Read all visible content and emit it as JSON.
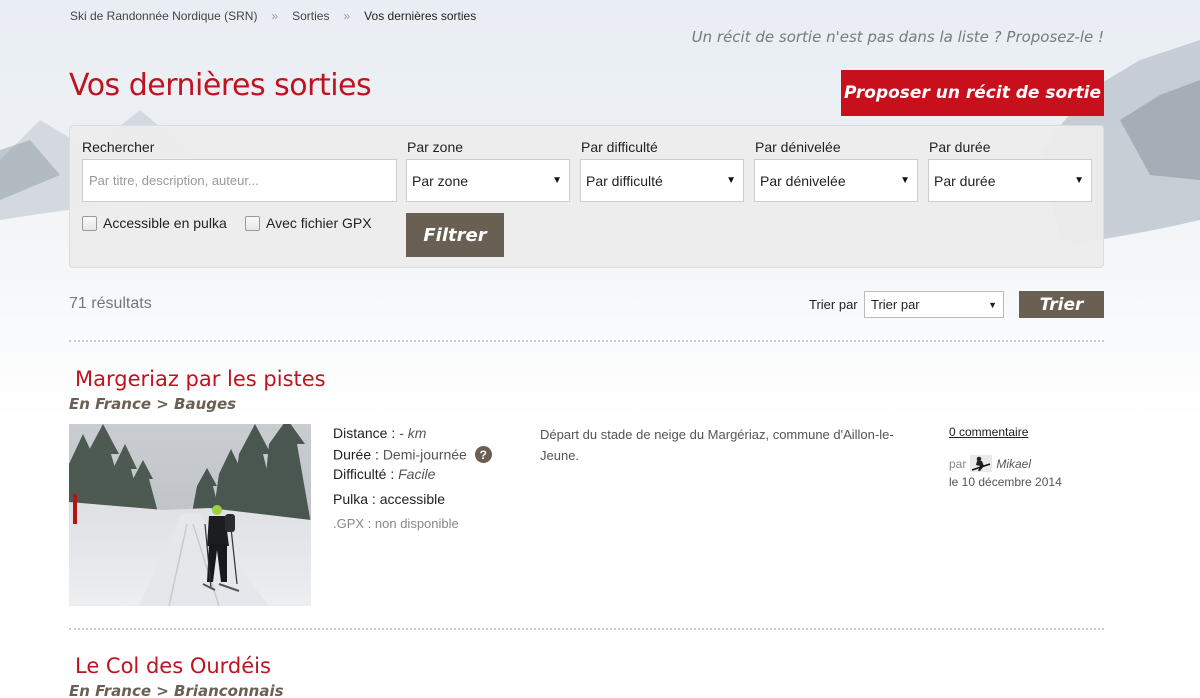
{
  "breadcrumb": {
    "items": [
      "Ski de Randonnée Nordique (SRN)",
      "Sorties",
      "Vos dernières sorties"
    ],
    "separator": "»"
  },
  "header": {
    "propose_text": "Un récit de sortie n'est pas dans la liste ? Proposez-le !",
    "title": "Vos dernières sorties",
    "propose_button": "Proposer un récit de sortie"
  },
  "filters": {
    "search_label": "Rechercher",
    "search_placeholder": "Par titre, description, auteur...",
    "zone_label": "Par zone",
    "zone_value": "Par zone",
    "difficulty_label": "Par difficulté",
    "difficulty_value": "Par difficulté",
    "elevation_label": "Par dénivelée",
    "elevation_value": "Par dénivelée",
    "duration_label": "Par durée",
    "duration_value": "Par durée",
    "pulka_label": "Accessible en pulka",
    "gpx_label": "Avec fichier GPX",
    "filter_button": "Filtrer"
  },
  "results": {
    "count": "71 résultats",
    "sort_label": "Trier par",
    "sort_value": "Trier par",
    "sort_button": "Trier"
  },
  "outings": [
    {
      "title": "Margeriaz par les pistes",
      "zone": "En France > Bauges",
      "distance_label": "Distance :",
      "distance_value": "- km",
      "duration_label": "Durée :",
      "duration_value": "Demi-journée",
      "difficulty_label": "Difficulté :",
      "difficulty_value": "Facile",
      "pulka": "Pulka : accessible",
      "gpx": ".GPX : non disponible",
      "description": "Départ du stade de neige du Margériaz, commune d'Aillon-le-Jeune.",
      "comments": "0 commentaire",
      "by": "par",
      "author": "Mikael",
      "date": "le 10 décembre 2014"
    },
    {
      "title": "Le Col des Ourdéis",
      "zone": "En France > Brianconnais"
    }
  ],
  "colors": {
    "accent_red": "#c8101d",
    "button_brown": "#6a5f53"
  }
}
